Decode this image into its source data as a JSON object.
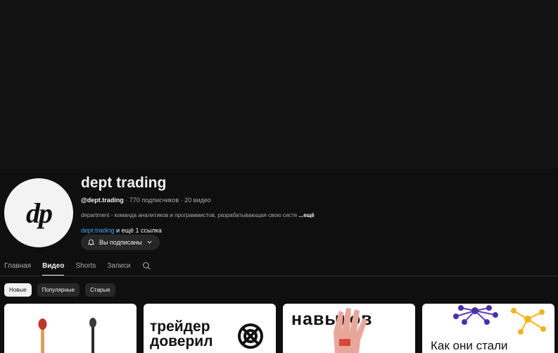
{
  "channel": {
    "name": "dept trading",
    "handle": "@dept.trading",
    "subscribers": "770 подписчиков",
    "videos": "20 видео",
    "separator": "·",
    "description": "department - команда аналитиков и программистов, разрабатывающая свою систе",
    "more": "...ещё",
    "link": "dept.trading",
    "link_more": " и ещё 1 ссылка",
    "avatar_text": "dp",
    "subscribe_label": "Вы подписаны"
  },
  "tabs": [
    {
      "label": "Главная"
    },
    {
      "label": "Видео"
    },
    {
      "label": "Shorts"
    },
    {
      "label": "Записи"
    }
  ],
  "active_tab": "Видео",
  "chips": [
    {
      "label": "Новые"
    },
    {
      "label": "Популярные"
    },
    {
      "label": "Старые"
    }
  ],
  "active_chip": "Новые",
  "thumbnails": [
    {
      "text": ""
    },
    {
      "text_line1": "трейдер",
      "text_line2": "доверил"
    },
    {
      "text": "навыков"
    },
    {
      "text": "Как они стали"
    }
  ],
  "colors": {
    "background": "#0f0f0f",
    "link": "#3ea6ff",
    "chip": "#272727"
  }
}
